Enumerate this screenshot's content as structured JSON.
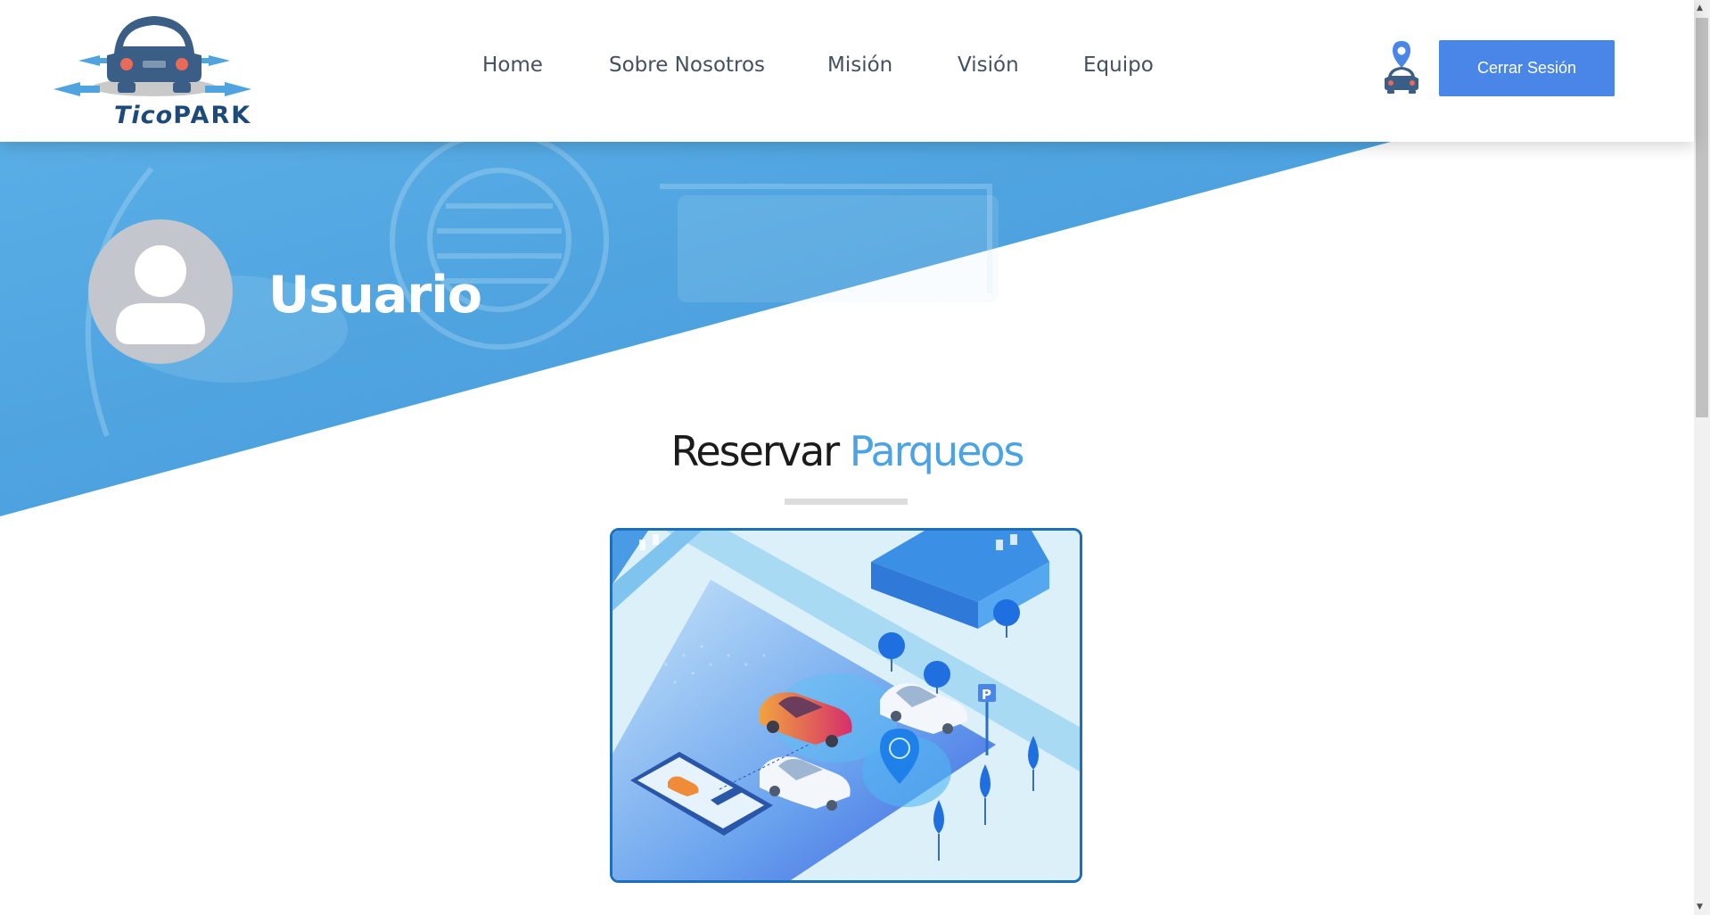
{
  "brand": {
    "logo_text_1": "Tico",
    "logo_text_2": "PARK"
  },
  "nav": {
    "items": [
      {
        "label": "Home"
      },
      {
        "label": "Sobre Nosotros"
      },
      {
        "label": "Misión"
      },
      {
        "label": "Visión"
      },
      {
        "label": "Equipo"
      }
    ]
  },
  "header": {
    "logout_label": "Cerrar Sesión"
  },
  "hero": {
    "user_title": "Usuario"
  },
  "section": {
    "title_part1": "Reservar",
    "title_part2": "Parqueos"
  },
  "colors": {
    "accent": "#4a86e8",
    "hero_blue": "#4fa3df",
    "title_highlight": "#4ba3e3",
    "card_border": "#1f6fb8"
  },
  "icons": {
    "logo": "car-logo-icon",
    "location_car": "location-car-icon",
    "avatar": "user-avatar-icon",
    "card_image": "parking-illustration"
  }
}
